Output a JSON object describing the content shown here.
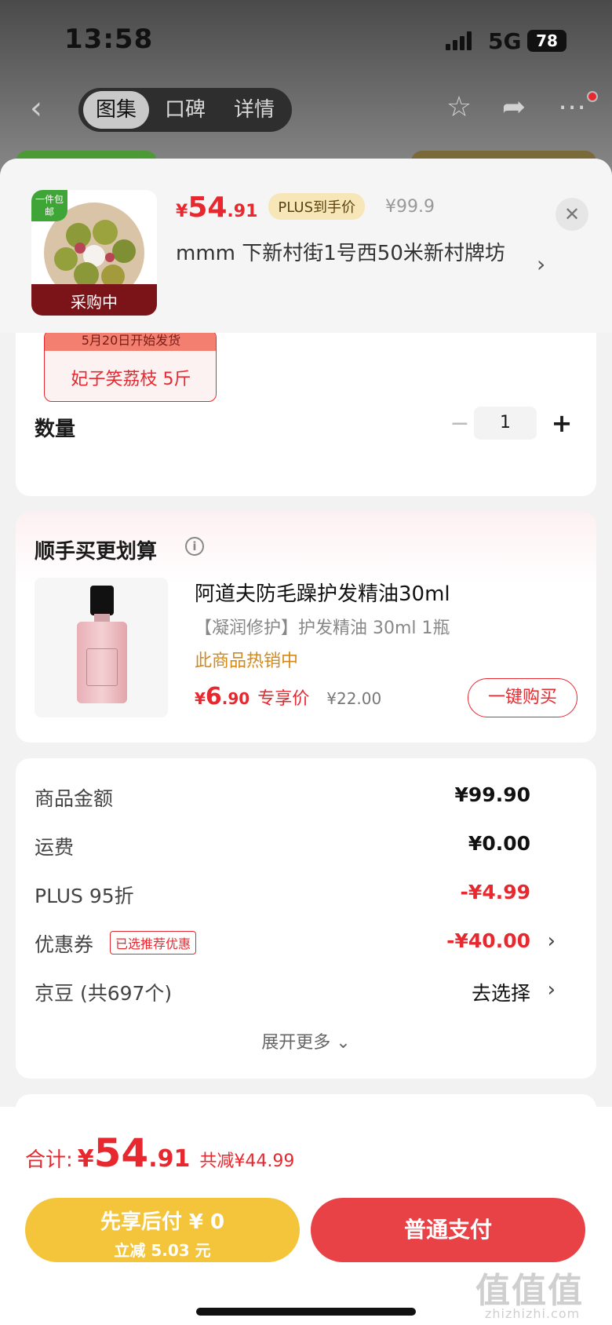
{
  "status_bar": {
    "time": "13:58",
    "network": "5G",
    "battery": "78"
  },
  "nav": {
    "back_icon": "chevron-left-icon",
    "tabs": [
      {
        "label": "图集",
        "active": true
      },
      {
        "label": "口碑",
        "active": false
      },
      {
        "label": "详情",
        "active": false
      }
    ],
    "icons": [
      "star-icon",
      "share-icon",
      "more-icon"
    ]
  },
  "header": {
    "thumb_badge": "一件包邮",
    "thumb_status": "采购中",
    "price_symbol": "¥",
    "price_int": "54",
    "price_dec": ".91",
    "plus_tag": "PLUS到手价",
    "original_price": "¥99.9",
    "address": "mmm  下新村街1号西50米新村牌坊",
    "close_icon": "close-icon"
  },
  "spec": {
    "ship_note": "5月20日开始发货",
    "name": "妃子笑荔枝 5斤"
  },
  "quantity": {
    "label": "数量",
    "minus": "−",
    "value": "1",
    "plus": "+"
  },
  "addon": {
    "title": "顺手买更划算",
    "info_icon": "i",
    "product_name": "阿道夫防毛躁护发精油30ml",
    "product_spec": "【凝润修护】护发精油 30ml 1瓶",
    "hot": "此商品热销中",
    "price_symbol": "¥",
    "price_int": "6",
    "price_dec": ".90",
    "exclusive": "专享价",
    "original_price": "¥22.00",
    "buy_button": "一键购买"
  },
  "summary": {
    "rows": [
      {
        "label": "商品金额",
        "value": "¥99.90"
      },
      {
        "label": "运费",
        "value": "¥0.00"
      },
      {
        "label": "PLUS 95折",
        "value": "-¥4.99"
      },
      {
        "label": "优惠券",
        "tag": "已选推荐优惠",
        "value": "-¥40.00"
      },
      {
        "label": "京豆 (共697个)",
        "value": "去选择"
      }
    ],
    "expand": "展开更多 ⌄"
  },
  "footer": {
    "total_label": "合计:",
    "total_symbol": "¥",
    "total_int": "54",
    "total_dec": ".91",
    "total_save": "共减¥44.99",
    "pay_later_title": "先享后付 ¥ 0",
    "pay_later_sub": "立减 5.03 元",
    "pay_normal": "普通支付"
  },
  "watermark": {
    "text": "值值值",
    "site": "zhizhizhi.com"
  },
  "colors": {
    "accent_red": "#e8282f",
    "pay_later_yellow": "#f4c53b",
    "pay_red": "#e84247"
  }
}
